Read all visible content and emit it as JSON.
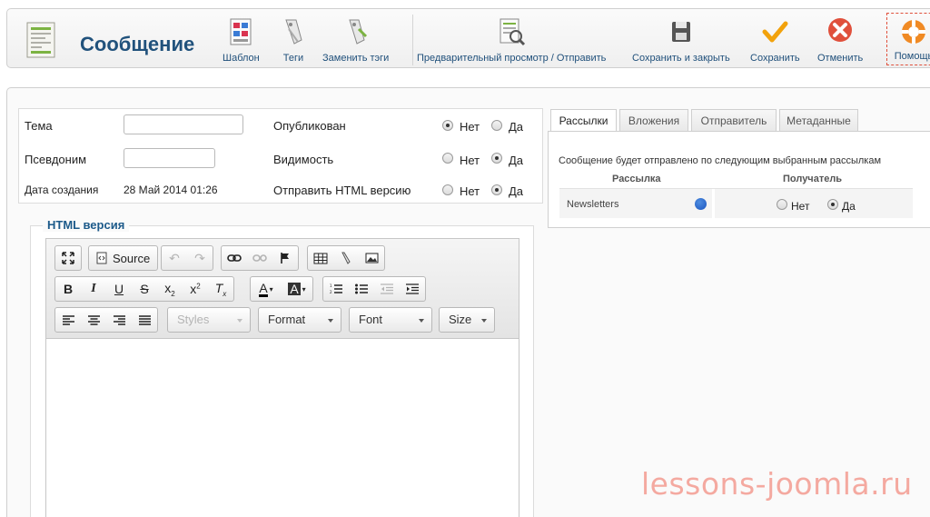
{
  "header": {
    "title": "Сообщение",
    "buttons": [
      {
        "label": "Шаблон",
        "icon": "template-icon"
      },
      {
        "label": "Теги",
        "icon": "tags-icon"
      },
      {
        "label": "Заменить тэги",
        "icon": "replace-tags-icon"
      },
      {
        "label": "Предварительный просмотр / Отправить",
        "icon": "preview-icon"
      },
      {
        "label": "Сохранить и закрыть",
        "icon": "floppy-icon"
      },
      {
        "label": "Сохранить",
        "icon": "checkmark-icon"
      },
      {
        "label": "Отменить",
        "icon": "cancel-icon"
      },
      {
        "label": "Помощь",
        "icon": "help-lifebuoy-icon"
      }
    ]
  },
  "form": {
    "subject_label": "Тема",
    "subject_value": "",
    "alias_label": "Псевдоним",
    "alias_value": "",
    "created_label": "Дата создания",
    "created_value": "28 Май 2014 01:26",
    "published_label": "Опубликован",
    "visibility_label": "Видимость",
    "send_html_label": "Отправить HTML версию",
    "no": "Нет",
    "yes": "Да",
    "published_selected": "Нет",
    "visibility_selected": "Да",
    "send_html_selected": "Да"
  },
  "editor": {
    "legend": "HTML версия",
    "source_label": "Source",
    "styles_label": "Styles",
    "format_label": "Format",
    "font_label": "Font",
    "size_label": "Size"
  },
  "tabs": [
    {
      "label": "Рассылки",
      "active": true
    },
    {
      "label": "Вложения",
      "active": false
    },
    {
      "label": "Отправитель",
      "active": false
    },
    {
      "label": "Метаданные",
      "active": false
    }
  ],
  "lists_panel": {
    "description": "Сообщение будет отправлено по следующим выбранным рассылкам",
    "col_list": "Рассылка",
    "col_recipient": "Получатель",
    "rows": [
      {
        "name": "Newsletters",
        "recipient_no": "Нет",
        "recipient_yes": "Да",
        "selected": "Да"
      }
    ]
  },
  "watermark": "lessons-joomla.ru",
  "colors": {
    "title": "#21527c",
    "link": "#1f4f7a",
    "accent_red": "#e0503c",
    "watermark": "#f4a9a0"
  }
}
